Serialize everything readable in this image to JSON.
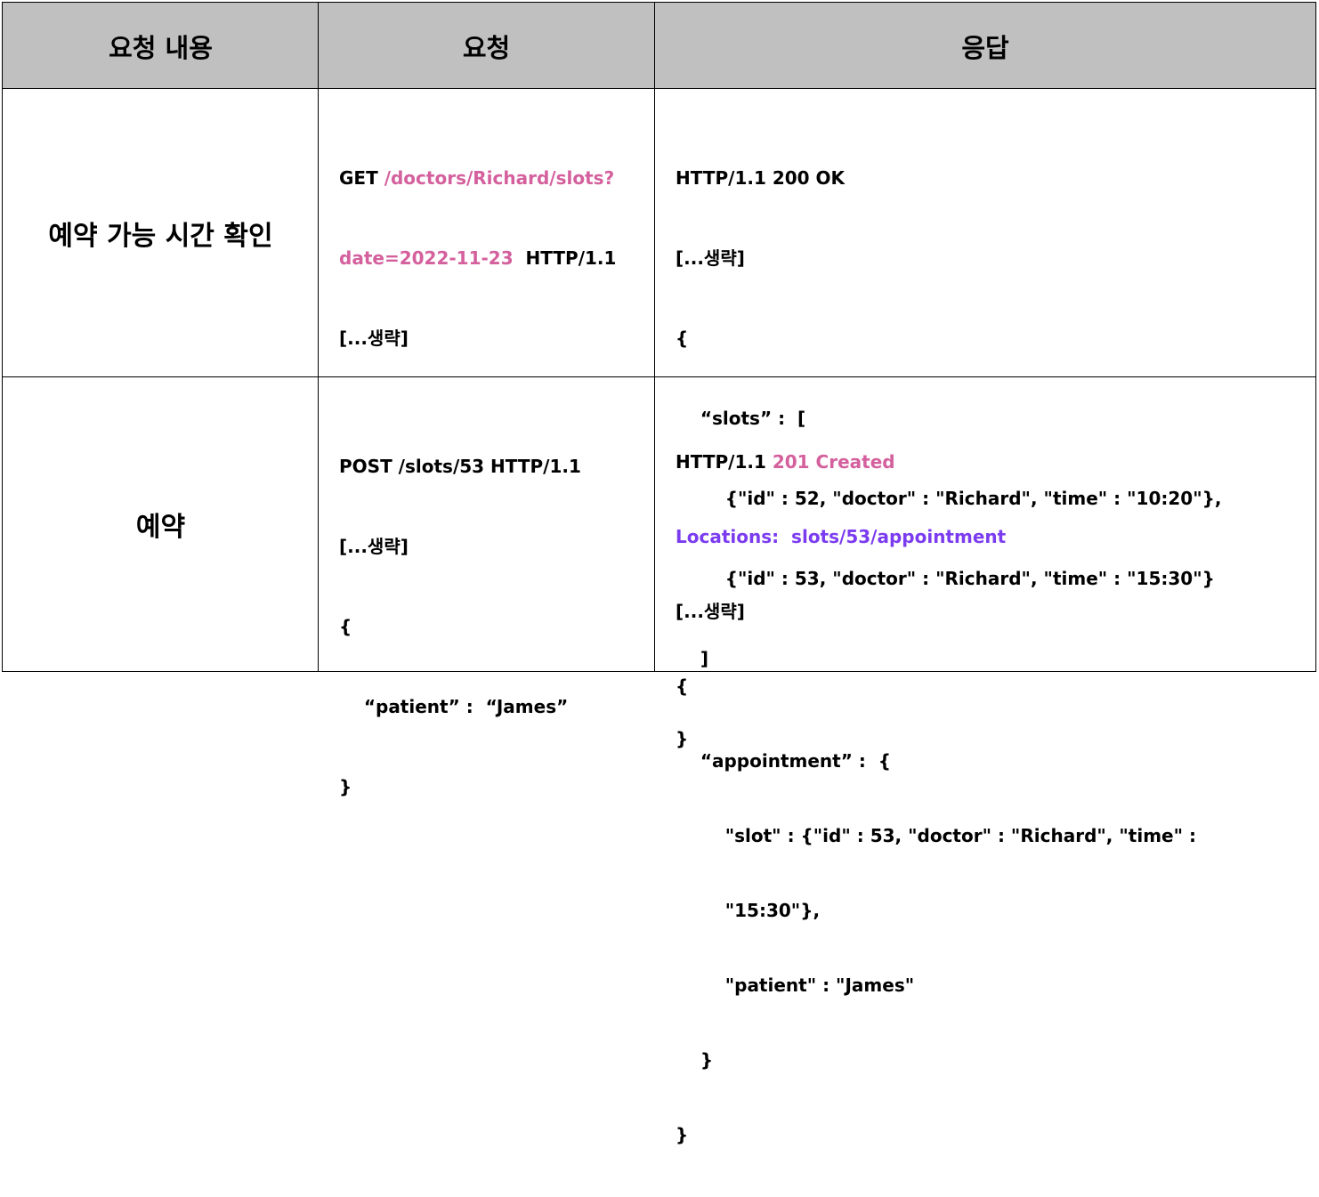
{
  "colors": {
    "header_bg": "#c0c0c0",
    "accent_pink": "#d4609d",
    "accent_purple": "#7b3cf0"
  },
  "header": {
    "col1": "요청 내용",
    "col2": "요청",
    "col3": "응답"
  },
  "rows": [
    {
      "label": "예약 가능 시간 확인",
      "request": {
        "l1_method": "GET ",
        "l1_path": "/doctors/Richard/slots?",
        "l2_query": "date=2022-11-23",
        "l2_proto": "  HTTP/1.1",
        "l3": "[...생략]"
      },
      "response": {
        "l1": "HTTP/1.1 200 OK",
        "l2": "[...생략]",
        "l3": "{",
        "l4": "    “slots” :  [",
        "l5": "        {\"id\" : 52, \"doctor\" : \"Richard\", \"time\" : \"10:20\"},",
        "l6": "        {\"id\" : 53, \"doctor\" : \"Richard\", \"time\" : \"15:30\"}",
        "l7": "    ]",
        "l8": "}"
      }
    },
    {
      "label": "예약",
      "request": {
        "l1": "POST /slots/53 HTTP/1.1",
        "l2": "[...생략]",
        "l3": "{",
        "l4": "    “patient” :  “James”",
        "l5": "}"
      },
      "response": {
        "l1_proto": "HTTP/1.1 ",
        "l1_status": "201 Created",
        "l2": "Locations:  slots/53/appointment",
        "l3": "[...생략]",
        "l4": "{",
        "l5": "    “appointment” :  {",
        "l6": "        \"slot\" : {\"id\" : 53, \"doctor\" : \"Richard\", \"time\" :",
        "l7": "        \"15:30\"},",
        "l8": "        \"patient\" : \"James\"",
        "l9": "    }",
        "l10": "}"
      }
    }
  ]
}
